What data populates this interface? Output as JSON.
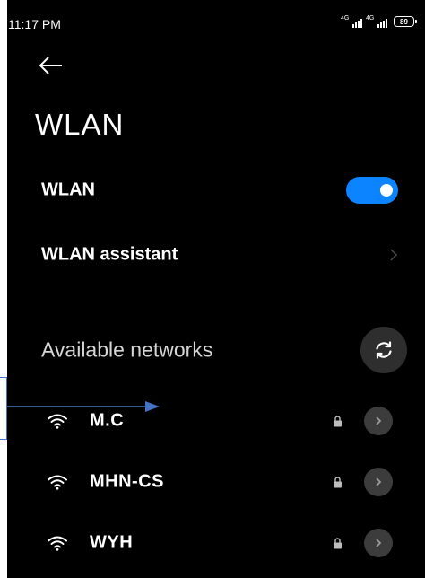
{
  "status_bar": {
    "time": "11:17 PM",
    "signal_1_label": "4G",
    "signal_2_label": "4G",
    "battery": "89"
  },
  "header": {
    "back_icon": "back-arrow-icon",
    "title": "WLAN"
  },
  "settings": {
    "wlan_label": "WLAN",
    "wlan_enabled": true,
    "assistant_label": "WLAN assistant"
  },
  "networks_section": {
    "title": "Available networks",
    "refresh_icon": "refresh-icon"
  },
  "networks": [
    {
      "name": "M.C",
      "secured": true
    },
    {
      "name": "MHN-CS",
      "secured": true
    },
    {
      "name": "WYH",
      "secured": true
    }
  ],
  "colors": {
    "background": "#000000",
    "accent": "#0d84ff",
    "annotation": "#4472c4"
  }
}
